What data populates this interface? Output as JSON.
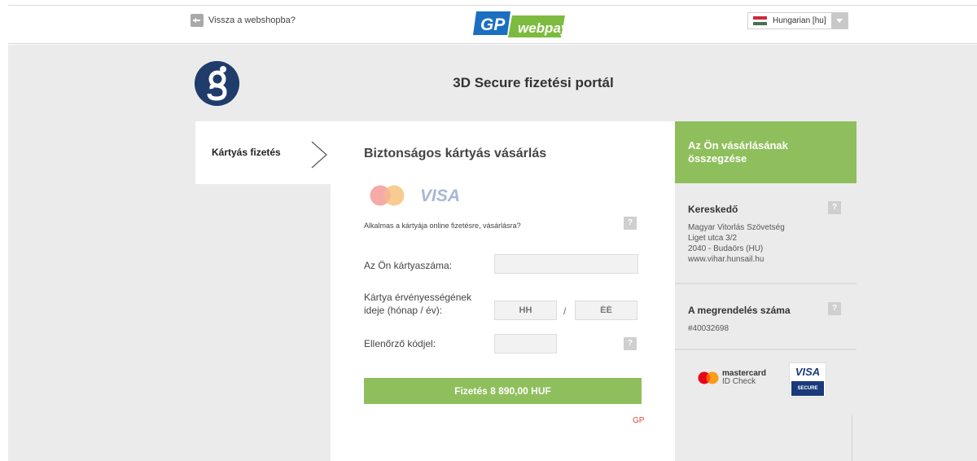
{
  "header": {
    "back_label": "Vissza a webshopba?",
    "logo_gp": "GP",
    "logo_webpay": "webpay",
    "language": "Hungarian [hu]"
  },
  "portal": {
    "title": "3D Secure fizetési portál"
  },
  "nav": {
    "active_label": "Kártyás fizetés"
  },
  "form": {
    "title": "Biztonságos kártyás vásárlás",
    "visa_text": "VISA",
    "card_question": "Alkalmas a kártyája online fizetésre, vásárlásra?",
    "card_number_label": "Az Ön kártyaszáma:",
    "card_number_value": "",
    "expiry_label_line1": "Kártya érvényességének",
    "expiry_label_line2": "ideje (hónap / év):",
    "month_placeholder": "HH",
    "year_placeholder": "ÉÉ",
    "slash": "/",
    "cvc_label": "Ellenőrző kódjel:",
    "cvc_value": "",
    "pay_button": "Fizetés 8 890,00 HUF",
    "gp_mark": "GP",
    "help_mark": "?"
  },
  "summary": {
    "title": "Az Ön vásárlásának összegzése",
    "merchant_title": "Kereskedő",
    "merchant_name": "Magyar Vitorlás Szövetség",
    "merchant_street": "Liget utca 3/2",
    "merchant_city": "2040 - Budaörs (HU)",
    "merchant_web": "www.vihar.hunsail.hu",
    "order_title": "A megrendelés száma",
    "order_number": "#40032698",
    "mc_id_line1": "mastercard",
    "mc_id_line2": "ID Check",
    "visa_secure_top": "VISA",
    "visa_secure_bottom": "SECURE"
  },
  "colors": {
    "accent_green": "#8fbf5c",
    "navy": "#1f3c6b",
    "gp_blue": "#1b6fc0",
    "webpay_green": "#7dbb3e"
  }
}
